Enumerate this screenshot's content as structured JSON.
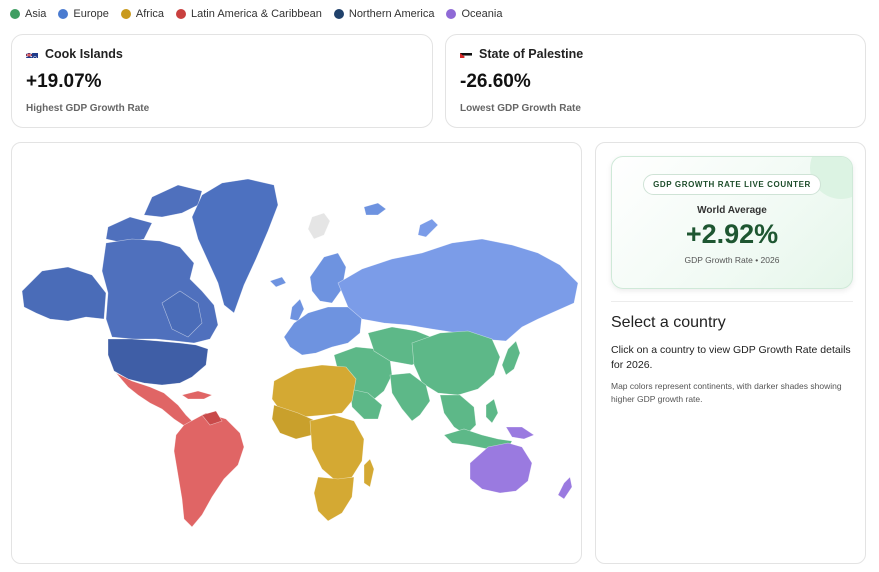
{
  "legend": [
    {
      "label": "Asia",
      "color": "#3f9e62"
    },
    {
      "label": "Europe",
      "color": "#4a7bd0"
    },
    {
      "label": "Africa",
      "color": "#c99a1e"
    },
    {
      "label": "Latin America & Caribbean",
      "color": "#c9403f"
    },
    {
      "label": "Northern America",
      "color": "#20416b"
    },
    {
      "label": "Oceania",
      "color": "#8f6ad6"
    }
  ],
  "highest": {
    "country": "Cook Islands",
    "value": "+19.07%",
    "label": "Highest GDP Growth Rate"
  },
  "lowest": {
    "country": "State of Palestine",
    "value": "-26.60%",
    "label": "Lowest GDP Growth Rate"
  },
  "counter": {
    "badge": "GDP GROWTH RATE LIVE COUNTER",
    "title": "World Average",
    "value": "+2.92%",
    "subtitle": "GDP Growth Rate • 2026"
  },
  "info": {
    "title": "Select a country",
    "description": "Click on a country to view GDP Growth Rate details for 2026.",
    "note": "Map colors represent continents, with darker shades showing higher GDP growth rate."
  },
  "map_colors": {
    "north_america": "#4a6cb8",
    "usa": "#3f5ea6",
    "greenland": "#4d71c0",
    "canada": "#4f70bd",
    "latin_america": "#e06565",
    "europe": "#6e93e0",
    "russia": "#7b9ce8",
    "asia": "#5db888",
    "africa": "#d4a933",
    "oceania": "#9a7ae0",
    "antarctic_ice": "#e5e5e5"
  }
}
